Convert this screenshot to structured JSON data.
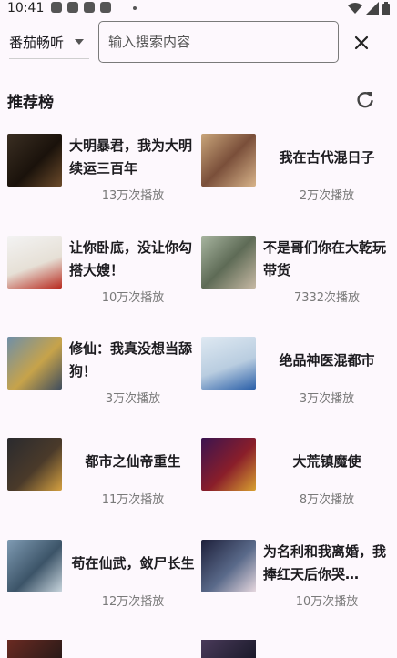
{
  "status_bar": {
    "time": "10:41",
    "icons": [
      "app-icon",
      "app-icon",
      "app-icon",
      "app-icon",
      "dot-icon",
      "wifi-icon",
      "signal-icon",
      "battery-icon"
    ]
  },
  "search_bar": {
    "source_label": "番茄畅听",
    "placeholder": "输入搜索内容",
    "value": ""
  },
  "section": {
    "title": "推荐榜"
  },
  "books": [
    {
      "title": "大明暴君，我为大明续运三百年",
      "plays": "13万次播放"
    },
    {
      "title": "我在古代混日子",
      "plays": "2万次播放"
    },
    {
      "title": "让你卧底，没让你勾搭大嫂！",
      "plays": "10万次播放"
    },
    {
      "title": "不是哥们你在大乾玩带货",
      "plays": "7332次播放"
    },
    {
      "title": "修仙：我真没想当舔狗！",
      "plays": "3万次播放"
    },
    {
      "title": "绝品神医混都市",
      "plays": "3万次播放"
    },
    {
      "title": "都市之仙帝重生",
      "plays": "11万次播放"
    },
    {
      "title": "大荒镇魔使",
      "plays": "8万次播放"
    },
    {
      "title": "苟在仙武，敛尸长生",
      "plays": "12万次播放"
    },
    {
      "title": "为名利和我离婚，我捧红天后你哭…",
      "plays": "10万次播放"
    }
  ],
  "colors": {
    "background": "#fdf8fd",
    "text_primary": "#1c1b1f",
    "text_secondary": "#7a7a7a"
  }
}
